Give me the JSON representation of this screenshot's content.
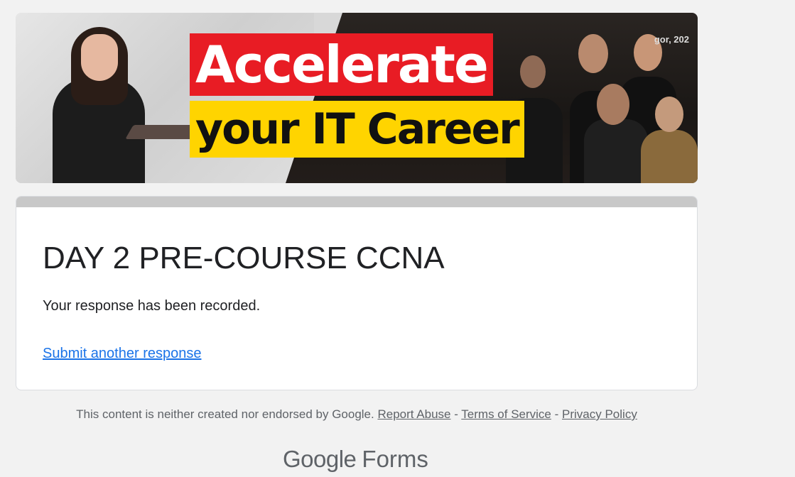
{
  "banner": {
    "headline_line1": "Accelerate",
    "headline_line2": "your IT Career",
    "event_text": "gor, 202"
  },
  "form": {
    "title": "DAY 2 PRE-COURSE CCNA",
    "confirmation": "Your response has been recorded.",
    "submit_another": "Submit another response"
  },
  "footer": {
    "disclaimer": "This content is neither created nor endorsed by Google.",
    "report_abuse": "Report Abuse",
    "separator": "-",
    "terms": "Terms of Service",
    "privacy": "Privacy Policy"
  },
  "brand": {
    "google": "Google",
    "forms": "Forms"
  },
  "colors": {
    "link": "#1a73e8",
    "headline_red": "#e81c24",
    "headline_yellow": "#ffd400"
  }
}
